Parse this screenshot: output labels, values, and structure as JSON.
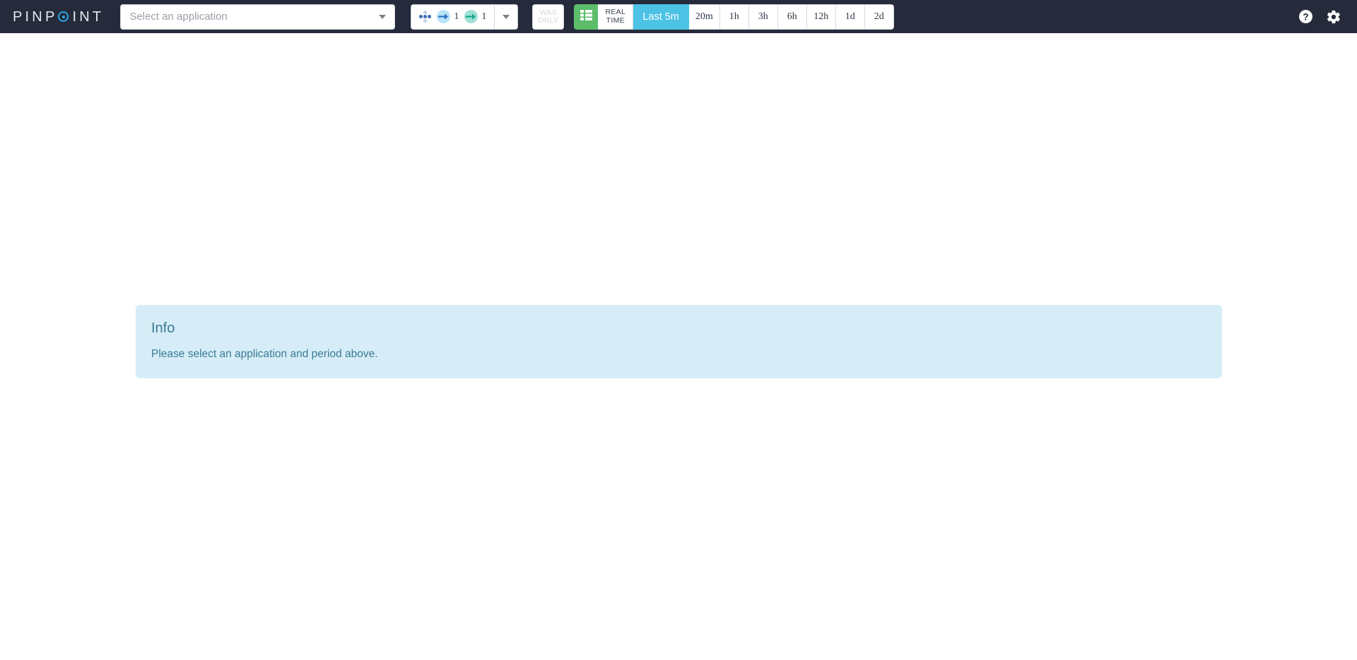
{
  "header": {
    "logo": {
      "prefix": "PINP",
      "o_icon": "target-circle-icon",
      "suffix": "INT",
      "full_text": "PINPOINT",
      "accent_color": "#2aa7e8"
    },
    "app_select": {
      "name": "application-select",
      "placeholder": "Select an application",
      "value": "",
      "caret_icon": "chevron-down-icon"
    },
    "transaction_filter": {
      "name": "transaction-filter",
      "dots_icon": "dot-cluster-icon",
      "stats": [
        {
          "icon": "arrow-right-icon",
          "icon_name": "inbound-transaction-arrow",
          "color": "#2f6fc4",
          "halo": "#b8e4f5",
          "count": "1"
        },
        {
          "icon": "arrow-right-icon",
          "icon_name": "outbound-transaction-arrow",
          "color": "#18a58c",
          "halo": "#9fe0d4",
          "count": "1"
        }
      ],
      "toggle_icon": "chevron-down-icon"
    },
    "was_only_button": {
      "line1": "WAS",
      "line2": "ONLY",
      "disabled": true
    },
    "view_buttons": {
      "grid_icon": "list-grid-icon",
      "grid_color": "#5cbd6a",
      "realtime": {
        "line1": "REAL",
        "line2": "TIME"
      }
    },
    "periods": [
      {
        "label": "Last 5m",
        "active": true
      },
      {
        "label": "20m",
        "active": false
      },
      {
        "label": "1h",
        "active": false
      },
      {
        "label": "3h",
        "active": false
      },
      {
        "label": "6h",
        "active": false
      },
      {
        "label": "12h",
        "active": false
      },
      {
        "label": "1d",
        "active": false
      },
      {
        "label": "2d",
        "active": false
      }
    ],
    "active_period_color": "#4cc2e4",
    "background_color": "#252b3a",
    "right_icons": [
      {
        "name": "help-icon",
        "glyph": "?"
      },
      {
        "name": "gear-icon",
        "glyph": "gear"
      }
    ]
  },
  "main": {
    "alert": {
      "title": "Info",
      "message": "Please select an application and period above.",
      "background_color": "#d6edf7",
      "text_color": "#3a7a95"
    }
  }
}
